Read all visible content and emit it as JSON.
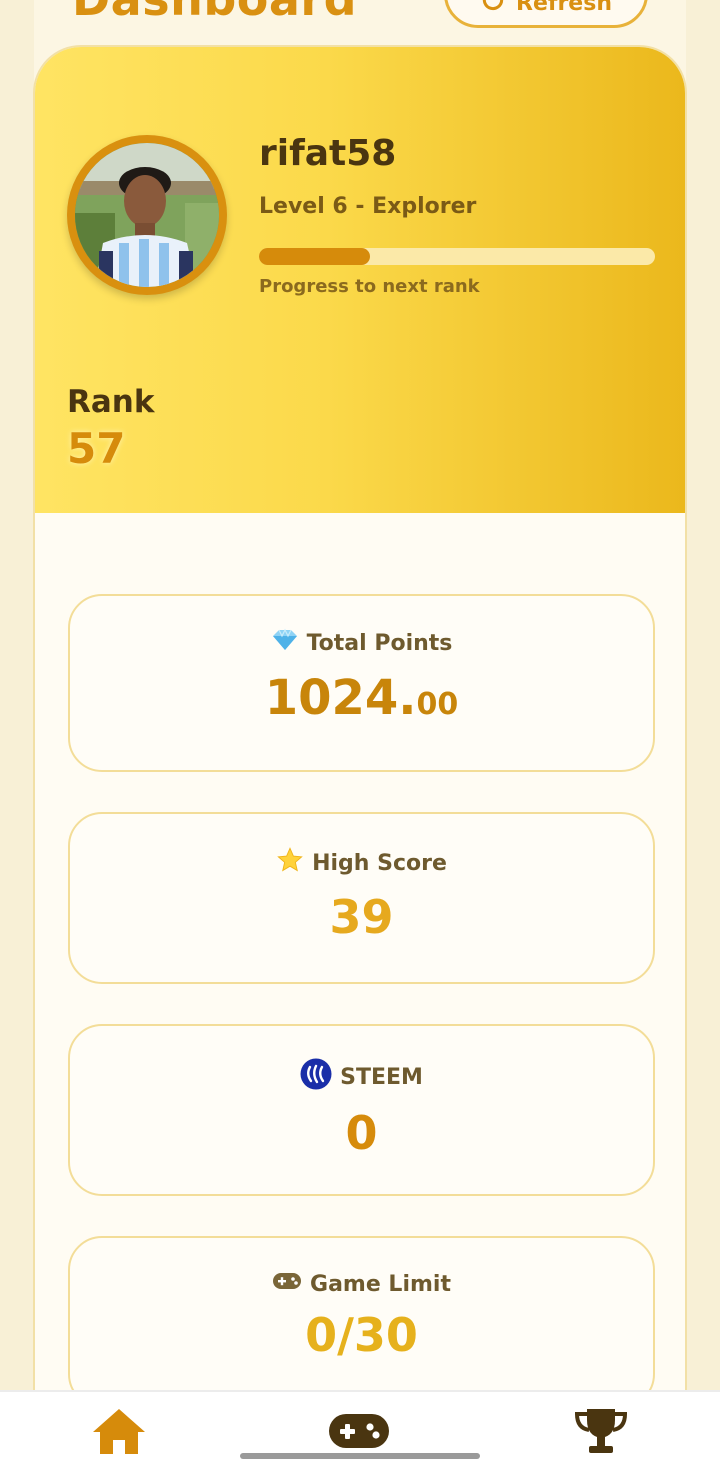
{
  "header": {
    "title": "Dashboard",
    "refresh_label": "Refresh"
  },
  "profile": {
    "username": "rifat58",
    "level": "Level 6 - Explorer",
    "progress_fraction": 0.28,
    "progress_label": "Progress to next rank",
    "rank_label": "Rank",
    "rank_value": "57"
  },
  "stats": {
    "total_points": {
      "icon": "gem-icon",
      "label": "Total Points",
      "value_int": "1024.",
      "value_dec": "00"
    },
    "high_score": {
      "icon": "star-icon",
      "label": "High Score",
      "value": "39"
    },
    "steem": {
      "icon": "steem-logo-icon",
      "label": "STEEM",
      "value": "0"
    },
    "game_limit": {
      "icon": "gamepad-icon",
      "label": "Game Limit",
      "value": "0/30"
    }
  },
  "nav": {
    "items": [
      {
        "icon": "home-icon",
        "color": "#d68b0b"
      },
      {
        "icon": "gamepad-icon",
        "color": "#4a3510"
      },
      {
        "icon": "trophy-icon",
        "color": "#4a3510"
      }
    ]
  },
  "colors": {
    "accent": "#d68b0b",
    "brand_dark": "#4a3510",
    "hero_gradient_start": "#ffe463",
    "hero_gradient_end": "#ebb81c"
  }
}
